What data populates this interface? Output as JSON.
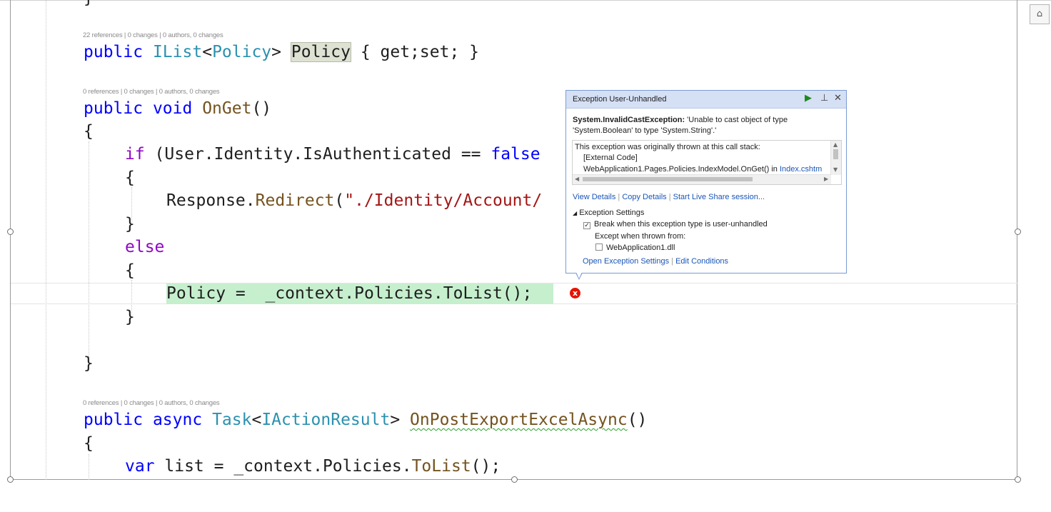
{
  "editor": {
    "lines": {
      "brace_top": "}",
      "lens1": "22 references | 0 changes | 0 authors, 0 changes",
      "l_policy": {
        "kw": "public",
        "type": "IList",
        "lt": "<",
        "type2": "Policy",
        "gt": ">",
        "name": "Policy",
        "rest": " { get;set; }"
      },
      "lens2": "0 references | 0 changes | 0 authors, 0 changes",
      "l_onget": {
        "kw1": "public",
        "kw2": "void",
        "meth": "OnGet",
        "rest": "()"
      },
      "l_open1": "{",
      "l_if": {
        "ctl": "if",
        "mid": " (User.Identity.IsAuthenticated == ",
        "kw": "false"
      },
      "l_open2": "{",
      "l_redirect": {
        "obj": "Response.",
        "meth": "Redirect",
        "paren": "(",
        "str": "\"./Identity/Account/"
      },
      "l_close2": "}",
      "l_else": "else",
      "l_open3": "{",
      "l_assign": {
        "text": "Policy =  _context.Policies.ToList();"
      },
      "l_close3": "}",
      "l_close1": "}",
      "lens3": "0 references | 0 changes | 0 authors, 0 changes",
      "l_post": {
        "kw1": "public",
        "kw2": "async",
        "type": "Task",
        "lt": "<",
        "type2": "IActionResult",
        "gt": ">",
        "meth": "OnPostExportExcelAsync",
        "rest": "()"
      },
      "l_open4": "{",
      "l_var": {
        "kw": "var",
        "mid": " list = _context.Policies.",
        "meth": "ToList",
        "rest": "();"
      }
    }
  },
  "error_glyph": "x",
  "exception_popup": {
    "title": "Exception User-Unhandled",
    "continue_icon": "play-icon",
    "pin_icon": "pin-icon",
    "close_icon": "close-icon",
    "exception_type": "System.InvalidCastException:",
    "message_a": " 'Unable to cast object of type",
    "message_b": "'System.Boolean' to type 'System.String'.'",
    "stack_header": "This exception was originally thrown at this call stack:",
    "stack_line1": "[External Code]",
    "stack_line2_text": "WebApplication1.Pages.Policies.IndexModel.OnGet() in ",
    "stack_line2_link": "Index.cshtm",
    "links": {
      "view_details": "View Details",
      "copy_details": "Copy Details",
      "live_share": "Start Live Share session..."
    },
    "separator": "|",
    "settings_header": "Exception Settings",
    "break_label": "Break when this exception type is user-unhandled",
    "break_checked": true,
    "except_label": "Except when thrown from:",
    "dll_label": "WebApplication1.dll",
    "dll_checked": false,
    "open_settings": "Open Exception Settings",
    "edit_conditions": "Edit Conditions"
  },
  "colors": {
    "keyword": "#0000ff",
    "type": "#2b91af",
    "method": "#74531f",
    "string": "#a31515",
    "control": "#8f08c4",
    "error": "#e51400"
  }
}
